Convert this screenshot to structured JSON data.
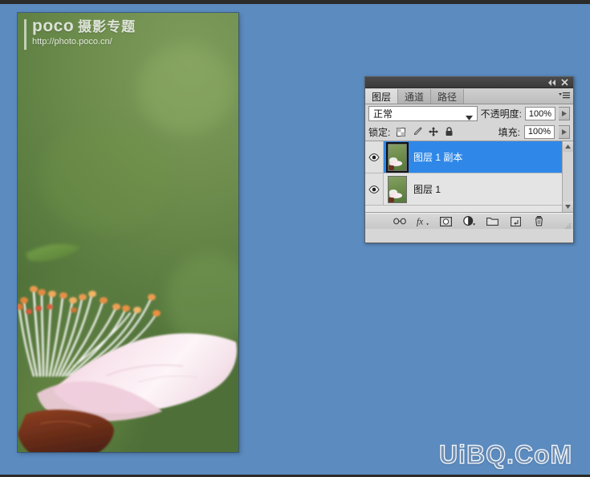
{
  "background": {
    "color": "#5b8bbf",
    "strip_color": "#2b2b2b"
  },
  "photo": {
    "watermark_brand": "poco",
    "watermark_brand_cn": "摄影专题",
    "watermark_url": "http://photo.poco.cn/",
    "subject": "cherry-blossom-macro"
  },
  "site_watermark": {
    "text": "UiBQ.CoM"
  },
  "panel": {
    "titlebar": {
      "collapse_label": "◄◄",
      "close_label": "✕"
    },
    "tabs": [
      {
        "label": "图层",
        "active": true
      },
      {
        "label": "通道",
        "active": false
      },
      {
        "label": "路径",
        "active": false
      }
    ],
    "menu_icon": "panel-menu-icon",
    "blend": {
      "mode_value": "正常",
      "opacity_label": "不透明度:",
      "opacity_value": "100%"
    },
    "lock": {
      "label": "锁定:",
      "fill_label": "填充:",
      "fill_value": "100%",
      "icons": [
        "transparency-lock-icon",
        "paint-lock-icon",
        "position-lock-icon",
        "all-lock-icon"
      ]
    },
    "layers": [
      {
        "name": "图层 1 副本",
        "visible": true,
        "selected": true
      },
      {
        "name": "图层 1",
        "visible": true,
        "selected": false
      }
    ],
    "bottom_icons": [
      "link-layers-icon",
      "layer-style-fx-icon",
      "add-layer-mask-icon",
      "adjustment-layer-icon",
      "new-group-icon",
      "new-layer-icon",
      "delete-layer-icon"
    ],
    "accent_color": "#2f88e8"
  }
}
